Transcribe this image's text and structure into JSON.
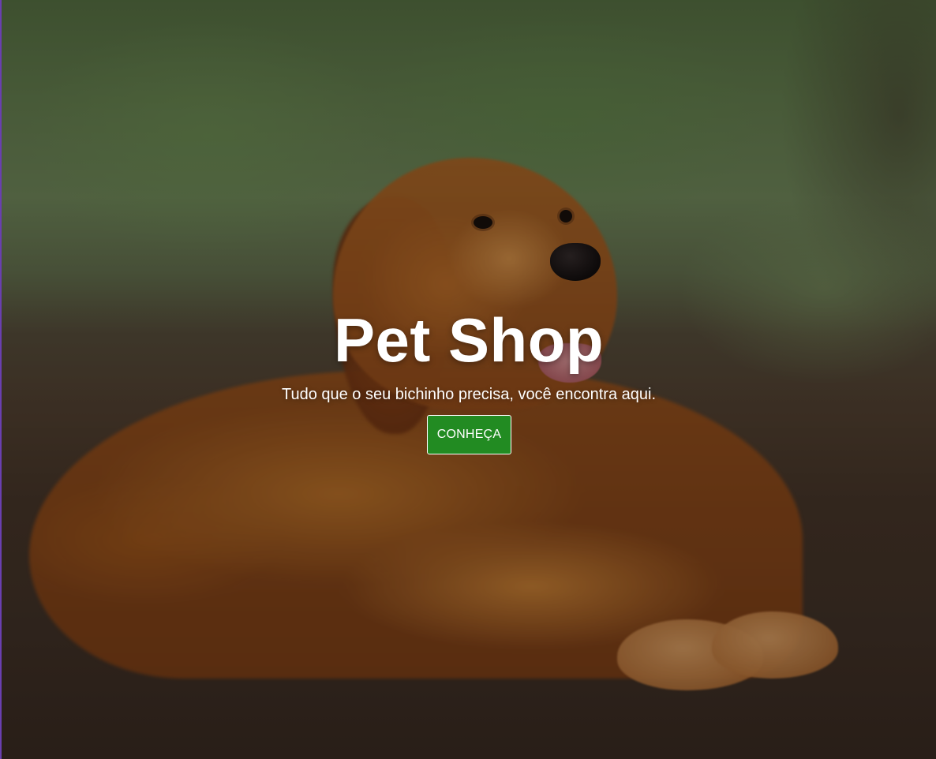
{
  "hero": {
    "title": "Pet Shop",
    "subtitle": "Tudo que o seu bichinho precisa, você encontra aqui.",
    "cta_label": "CONHEÇA"
  },
  "colors": {
    "cta_background": "#228b22",
    "cta_border": "#ffffff",
    "text": "#ffffff",
    "overlay": "rgba(0,0,0,0.35)"
  }
}
